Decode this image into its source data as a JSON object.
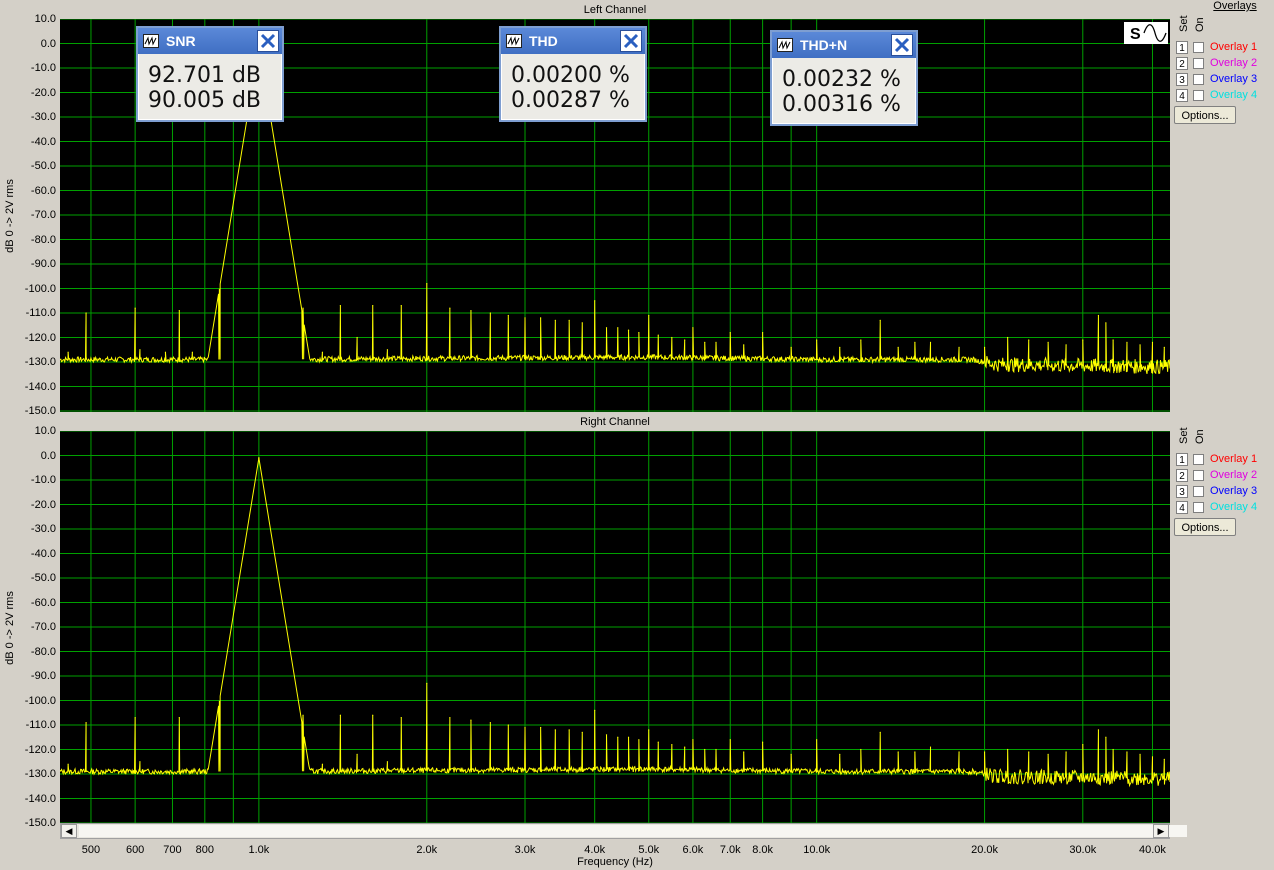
{
  "colors": {
    "trace": "#ffff00",
    "grid": "#00a000",
    "plot_bg": "#000000",
    "accent": "#4a7bd0"
  },
  "panels": [
    {
      "title": "Left Channel",
      "ylabel": "dB 0 -> 2V rms"
    },
    {
      "title": "Right Channel",
      "ylabel": "dB 0 -> 2V rms"
    }
  ],
  "y_ticks": [
    "10.0",
    "0.0",
    "-10.0",
    "-20.0",
    "-30.0",
    "-40.0",
    "-50.0",
    "-60.0",
    "-70.0",
    "-80.0",
    "-90.0",
    "-100.0",
    "-110.0",
    "-120.0",
    "-130.0",
    "-140.0",
    "-150.0"
  ],
  "x_ticks": [
    "500",
    "600",
    "700",
    "800",
    "1.0k",
    "2.0k",
    "3.0k",
    "4.0k",
    "5.0k",
    "6.0k",
    "7.0k",
    "8.0k",
    "10.0k",
    "20.0k",
    "30.0k",
    "40.0k"
  ],
  "xlabel": "Frequency (Hz)",
  "meters": {
    "snr": {
      "title": "SNR",
      "line1": "92.701 dB",
      "line2": "90.005 dB",
      "icon": "waveform-icon"
    },
    "thd": {
      "title": "THD",
      "line1": "0.00200 %",
      "line2": "0.00287 %",
      "icon": "waveform-icon"
    },
    "thdn": {
      "title": "THD+N",
      "line1": "0.00232 %",
      "line2": "0.00316 %",
      "icon": "waveform-icon"
    }
  },
  "overlays_panel": {
    "header": "Overlays",
    "set_label": "Set",
    "on_label": "On",
    "items": [
      {
        "num": "1",
        "label": "Overlay 1",
        "color": "#ff0000"
      },
      {
        "num": "2",
        "label": "Overlay 2",
        "color": "#e000e0"
      },
      {
        "num": "3",
        "label": "Overlay 3",
        "color": "#0000ff"
      },
      {
        "num": "4",
        "label": "Overlay 4",
        "color": "#00e0e0"
      }
    ],
    "options_label": "Options..."
  },
  "chart_data": [
    {
      "type": "line",
      "title": "Left Channel",
      "xlabel": "Frequency (Hz)",
      "ylabel": "dB 0 -> 2V rms",
      "xscale": "log",
      "xlim": [
        440,
        43000
      ],
      "ylim": [
        -150,
        10
      ],
      "grid": true,
      "noise_floor": [
        [
          440,
          -129
        ],
        [
          1000,
          -129
        ],
        [
          5000,
          -128
        ],
        [
          10000,
          -129
        ],
        [
          19000,
          -129
        ],
        [
          21000,
          -131
        ],
        [
          43000,
          -132
        ]
      ],
      "fundamental": {
        "x": 1000,
        "y": -1
      },
      "spurs": [
        [
          455,
          -126
        ],
        [
          490,
          -110
        ],
        [
          600,
          -108
        ],
        [
          612,
          -125
        ],
        [
          680,
          -126
        ],
        [
          720,
          -109
        ],
        [
          760,
          -126
        ],
        [
          850,
          -108
        ],
        [
          1200,
          -108
        ],
        [
          1300,
          -126
        ],
        [
          1400,
          -107
        ],
        [
          1500,
          -120
        ],
        [
          1600,
          -107
        ],
        [
          1700,
          -125
        ],
        [
          1800,
          -107
        ],
        [
          2000,
          -98
        ],
        [
          2200,
          -108
        ],
        [
          2400,
          -109
        ],
        [
          2600,
          -110
        ],
        [
          2800,
          -111
        ],
        [
          3000,
          -112
        ],
        [
          3200,
          -112
        ],
        [
          3400,
          -113
        ],
        [
          3600,
          -113
        ],
        [
          3800,
          -114
        ],
        [
          4000,
          -105
        ],
        [
          4200,
          -116
        ],
        [
          4400,
          -116
        ],
        [
          4600,
          -117
        ],
        [
          4800,
          -118
        ],
        [
          5000,
          -111
        ],
        [
          5200,
          -119
        ],
        [
          5500,
          -120
        ],
        [
          5800,
          -121
        ],
        [
          6000,
          -116
        ],
        [
          6300,
          -122
        ],
        [
          6600,
          -122
        ],
        [
          7000,
          -118
        ],
        [
          7400,
          -123
        ],
        [
          8000,
          -118
        ],
        [
          9000,
          -124
        ],
        [
          10000,
          -121
        ],
        [
          11000,
          -124
        ],
        [
          12000,
          -121
        ],
        [
          13000,
          -113
        ],
        [
          14000,
          -124
        ],
        [
          15000,
          -122
        ],
        [
          16000,
          -122
        ],
        [
          18000,
          -124
        ],
        [
          20000,
          -124
        ],
        [
          22000,
          -120
        ],
        [
          24000,
          -121
        ],
        [
          26000,
          -122
        ],
        [
          28000,
          -123
        ],
        [
          30000,
          -121
        ],
        [
          32000,
          -111
        ],
        [
          33000,
          -114
        ],
        [
          34000,
          -121
        ],
        [
          36000,
          -122
        ],
        [
          38000,
          -123
        ],
        [
          40000,
          -122
        ],
        [
          42000,
          -124
        ]
      ]
    },
    {
      "type": "line",
      "title": "Right Channel",
      "xlabel": "Frequency (Hz)",
      "ylabel": "dB 0 -> 2V rms",
      "xscale": "log",
      "xlim": [
        440,
        43000
      ],
      "ylim": [
        -150,
        10
      ],
      "grid": true,
      "noise_floor": [
        [
          440,
          -129
        ],
        [
          1000,
          -129
        ],
        [
          5000,
          -128
        ],
        [
          10000,
          -129
        ],
        [
          19000,
          -129
        ],
        [
          21000,
          -131
        ],
        [
          43000,
          -132
        ]
      ],
      "fundamental": {
        "x": 1000,
        "y": -1
      },
      "spurs": [
        [
          455,
          -126
        ],
        [
          490,
          -109
        ],
        [
          600,
          -107
        ],
        [
          612,
          -125
        ],
        [
          720,
          -107
        ],
        [
          850,
          -106
        ],
        [
          1200,
          -106
        ],
        [
          1300,
          -126
        ],
        [
          1400,
          -106
        ],
        [
          1500,
          -122
        ],
        [
          1600,
          -106
        ],
        [
          1700,
          -125
        ],
        [
          1800,
          -107
        ],
        [
          2000,
          -93
        ],
        [
          2200,
          -107
        ],
        [
          2400,
          -108
        ],
        [
          2600,
          -109
        ],
        [
          2800,
          -110
        ],
        [
          3000,
          -111
        ],
        [
          3200,
          -111
        ],
        [
          3400,
          -112
        ],
        [
          3600,
          -112
        ],
        [
          3800,
          -113
        ],
        [
          4000,
          -104
        ],
        [
          4200,
          -114
        ],
        [
          4400,
          -115
        ],
        [
          4600,
          -115
        ],
        [
          4800,
          -116
        ],
        [
          5000,
          -112
        ],
        [
          5200,
          -117
        ],
        [
          5500,
          -118
        ],
        [
          5800,
          -119
        ],
        [
          6000,
          -116
        ],
        [
          6300,
          -120
        ],
        [
          6600,
          -120
        ],
        [
          7000,
          -116
        ],
        [
          7400,
          -121
        ],
        [
          8000,
          -117
        ],
        [
          9000,
          -122
        ],
        [
          10000,
          -116
        ],
        [
          11000,
          -122
        ],
        [
          12000,
          -120
        ],
        [
          13000,
          -113
        ],
        [
          14000,
          -121
        ],
        [
          15000,
          -121
        ],
        [
          16000,
          -119
        ],
        [
          18000,
          -121
        ],
        [
          20000,
          -121
        ],
        [
          22000,
          -120
        ],
        [
          24000,
          -121
        ],
        [
          26000,
          -122
        ],
        [
          28000,
          -121
        ],
        [
          30000,
          -118
        ],
        [
          32000,
          -112
        ],
        [
          33000,
          -115
        ],
        [
          34000,
          -120
        ],
        [
          36000,
          -121
        ],
        [
          38000,
          -122
        ],
        [
          40000,
          -123
        ],
        [
          42000,
          -124
        ]
      ]
    }
  ]
}
